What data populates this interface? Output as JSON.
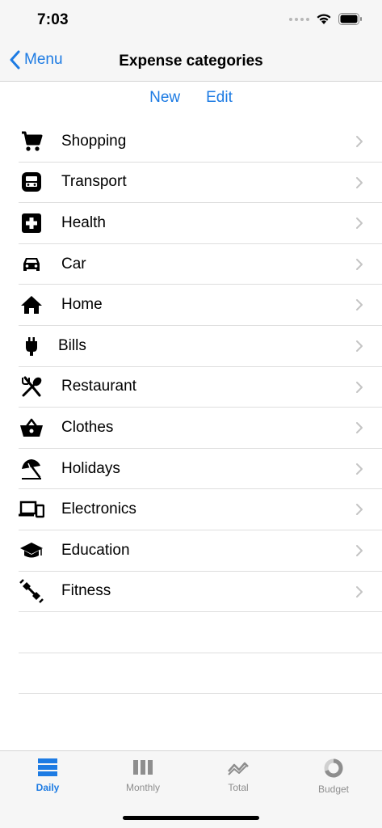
{
  "status_bar": {
    "time": "7:03"
  },
  "nav": {
    "back_label": "Menu",
    "title": "Expense categories"
  },
  "actions": {
    "new_label": "New",
    "edit_label": "Edit"
  },
  "categories": [
    {
      "label": "Shopping",
      "icon": "shopping-cart-icon"
    },
    {
      "label": "Transport",
      "icon": "bus-icon"
    },
    {
      "label": "Health",
      "icon": "medical-cross-icon"
    },
    {
      "label": "Car",
      "icon": "car-icon"
    },
    {
      "label": "Home",
      "icon": "house-icon"
    },
    {
      "label": "Bills",
      "icon": "plug-icon"
    },
    {
      "label": "Restaurant",
      "icon": "utensils-icon"
    },
    {
      "label": "Clothes",
      "icon": "basket-icon"
    },
    {
      "label": "Holidays",
      "icon": "beach-umbrella-icon"
    },
    {
      "label": "Electronics",
      "icon": "devices-icon"
    },
    {
      "label": "Education",
      "icon": "graduation-cap-icon"
    },
    {
      "label": "Fitness",
      "icon": "dumbbell-icon"
    }
  ],
  "tab_bar": {
    "tabs": [
      {
        "label": "Daily",
        "icon": "daily-bars-icon",
        "active": true
      },
      {
        "label": "Monthly",
        "icon": "monthly-columns-icon",
        "active": false
      },
      {
        "label": "Total",
        "icon": "trend-icon",
        "active": false
      },
      {
        "label": "Budget",
        "icon": "donut-icon",
        "active": false
      }
    ]
  },
  "colors": {
    "accent": "#1d7be3",
    "inactive": "#8e8e8e",
    "bar_bg": "#f6f6f6"
  }
}
